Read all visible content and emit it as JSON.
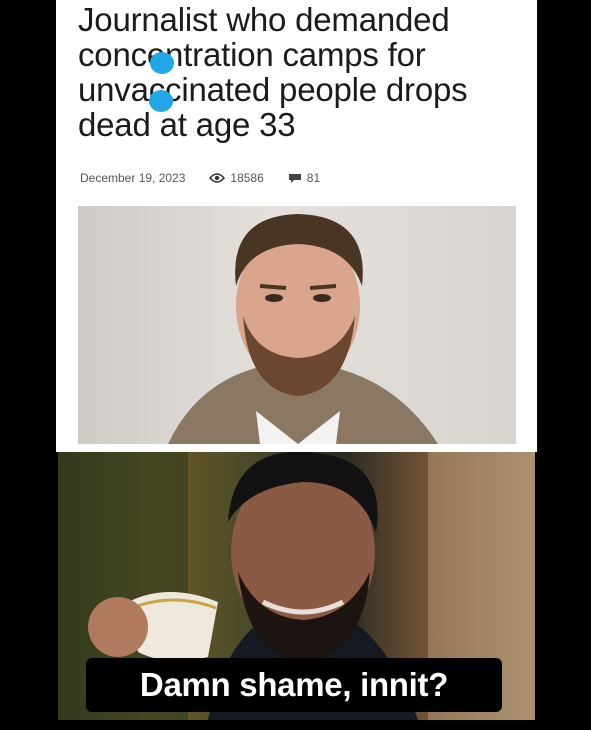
{
  "article": {
    "headline": "Journalist who demanded concentration camps for unvaccinated people drops dead at age 33",
    "date": "December 19, 2023",
    "views": "18586",
    "comments": "81"
  },
  "meme": {
    "caption": "Damn shame, innit?"
  },
  "colors": {
    "page_background": "#000000",
    "article_background": "#ffffff",
    "redaction_smudge": "#21a7e8"
  },
  "icons": [
    "eye-icon",
    "comment-icon"
  ]
}
